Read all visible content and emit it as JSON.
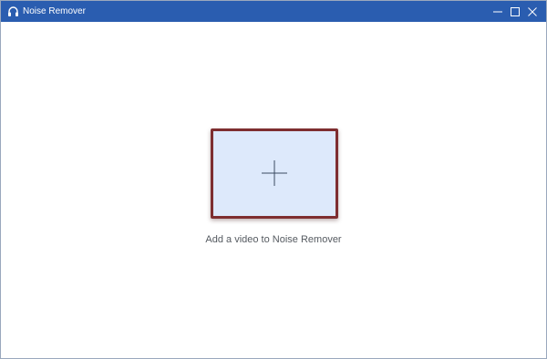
{
  "window": {
    "title": "Noise Remover",
    "app_icon": "headphones-icon",
    "controls": {
      "minimize_icon": "minimize-icon",
      "maximize_icon": "maximize-icon",
      "close_icon": "close-icon"
    },
    "titlebar_color": "#2a5db0"
  },
  "main": {
    "add_button_icon": "plus-icon",
    "add_caption": "Add a video to Noise Remover",
    "drop_area_color": "#dde9fb",
    "drop_area_border_color": "#7e2e30"
  }
}
